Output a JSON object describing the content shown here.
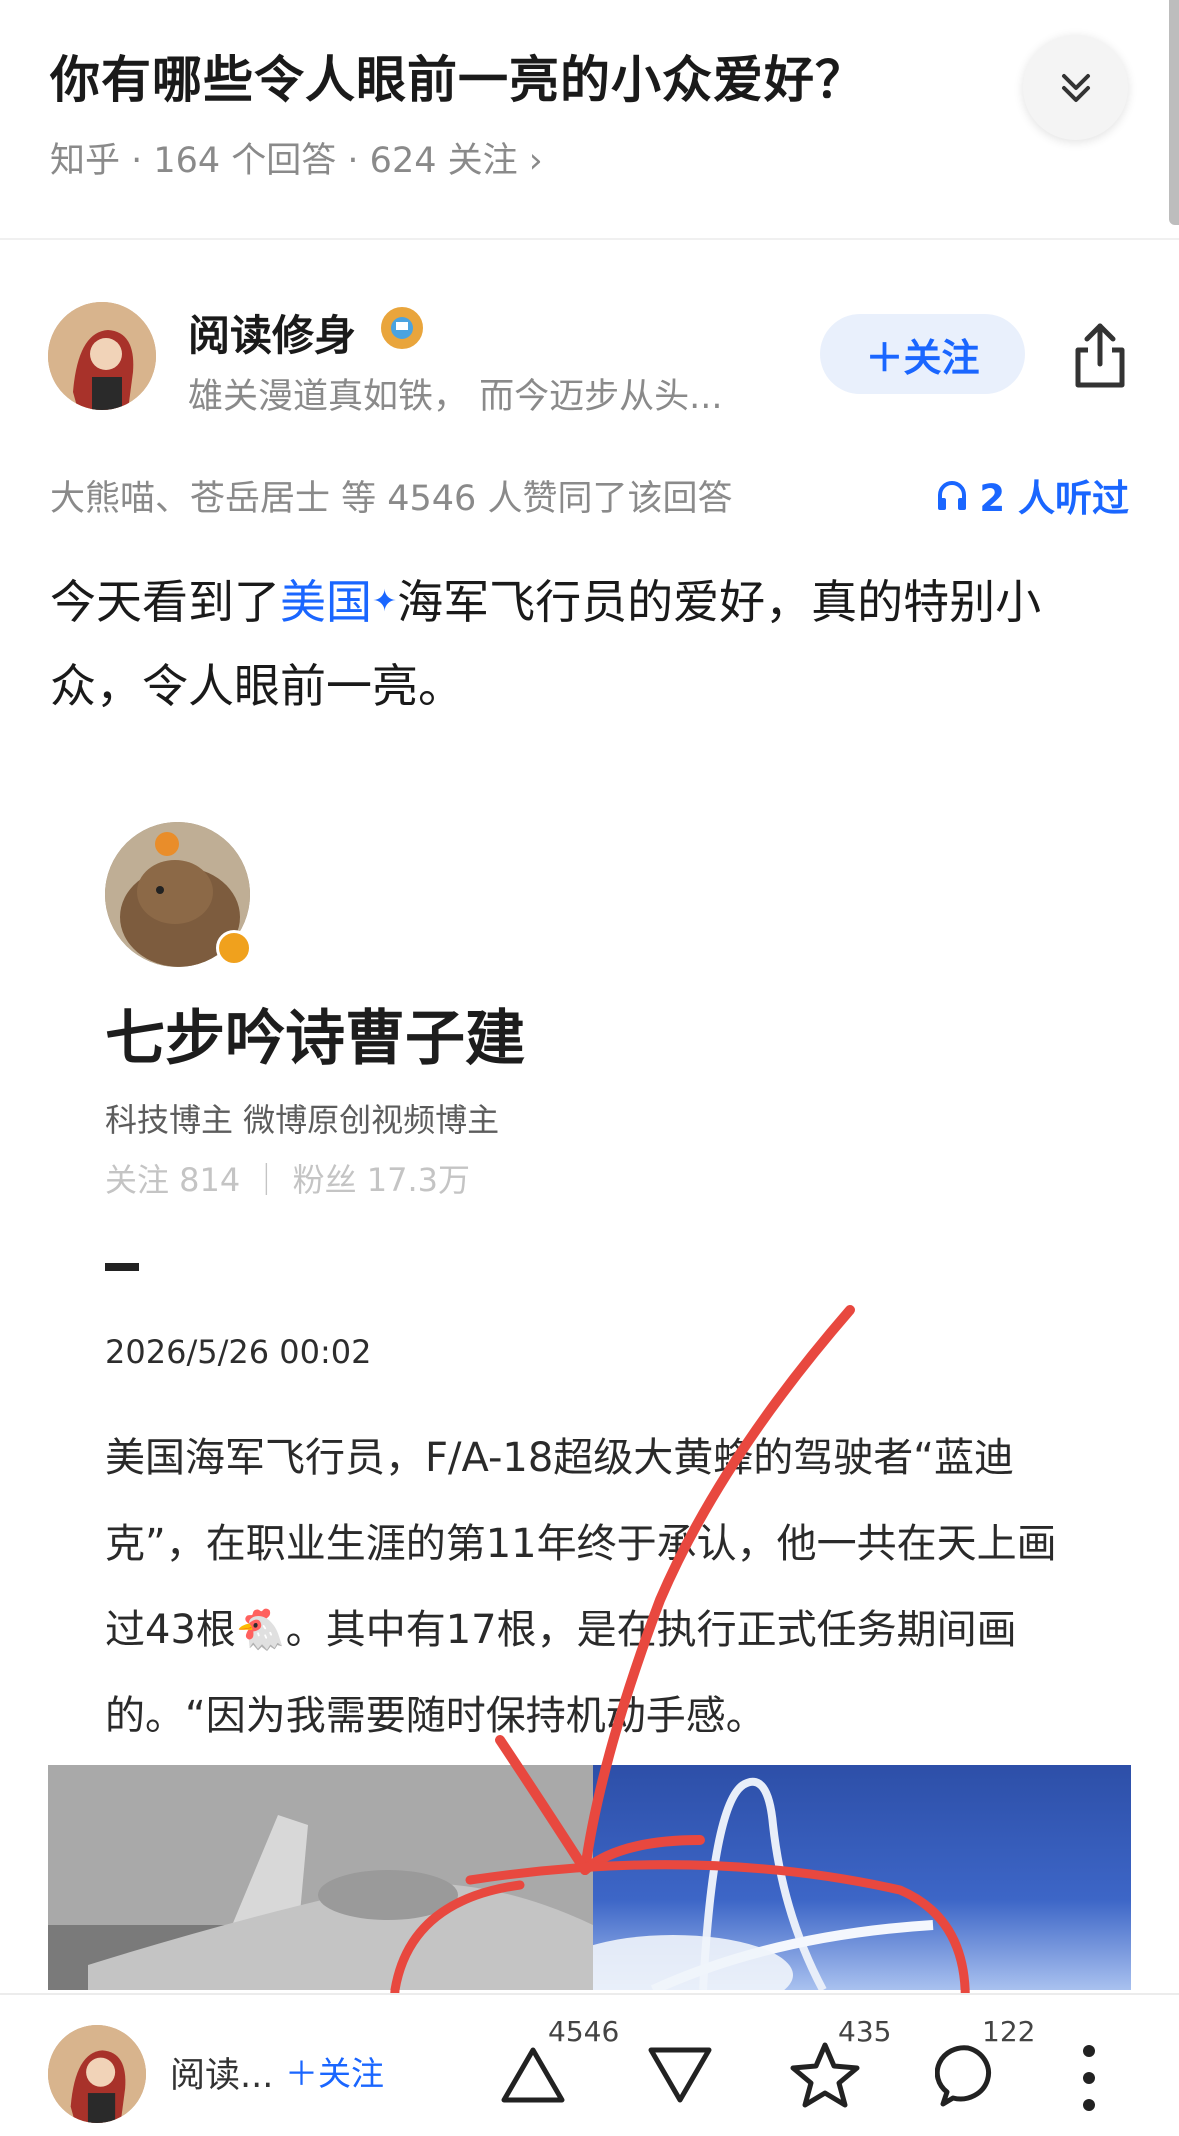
{
  "question": {
    "title": "你有哪些令人眼前一亮的小众爱好？",
    "meta": "知乎 · 164 个回答 · 624 关注 ›"
  },
  "author": {
    "name": "阅读修身",
    "bio": "雄关漫道真如铁，  而今迈步从头...",
    "follow_label": "＋关注"
  },
  "answer_meta": {
    "upvoters": "大熊喵、苍岳居士 等 4546 人赞同了该回答",
    "listened": "2 人听过"
  },
  "answer": {
    "text_before": "今天看到了",
    "link": "美国",
    "text_after": "海军飞行员的爱好，真的特别小众，令人眼前一亮。"
  },
  "embedded_post": {
    "name": "七步吟诗曹子建",
    "tags": "科技博主 微博原创视频博主",
    "stats": "关注 814 ｜ 粉丝 17.3万",
    "date": "2026/5/26 00:02",
    "body": "美国海军飞行员，F/A-18超级大黄蜂的驾驶者“蓝迪克”，在职业生涯的第11年终于承认，他一共在天上画过43根🐔。其中有17根，是在执行正式任务期间画的。“因为我需要随时保持机动手感。"
  },
  "bottom_bar": {
    "author_short": "阅读...",
    "follow_label": "＋关注",
    "upvote_count": "4546",
    "favorite_count": "435",
    "comment_count": "122"
  },
  "colors": {
    "accent": "#1a66ff",
    "annotation": "#e8483f"
  }
}
